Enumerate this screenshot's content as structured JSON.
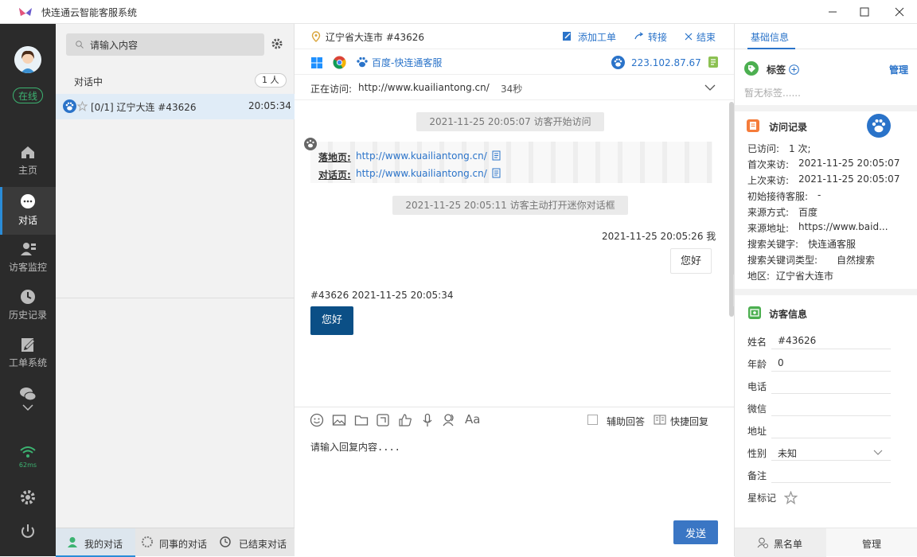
{
  "app": {
    "title": "快连通云智能客服系统"
  },
  "nav": {
    "status": "在线",
    "items": [
      {
        "label": "主页",
        "icon": "home-icon"
      },
      {
        "label": "对话",
        "icon": "chat-icon"
      },
      {
        "label": "访客监控",
        "icon": "monitor-icon"
      },
      {
        "label": "历史记录",
        "icon": "history-icon"
      },
      {
        "label": "工单系统",
        "icon": "ticket-icon"
      }
    ],
    "latency": "62ms"
  },
  "panel": {
    "search_placeholder": "请输入内容",
    "section_title": "对话中",
    "section_count": "1 人",
    "conversations": [
      {
        "title": "[0/1] 辽宁大连  #43626",
        "time": "20:05:34"
      }
    ],
    "tabs": {
      "mine": "我的对话",
      "colleague": "同事的对话",
      "ended": "已结束对话"
    }
  },
  "chat": {
    "location": "辽宁省大连市 #43626",
    "actions": {
      "add_ticket": "添加工单",
      "transfer": "转接",
      "end": "结束"
    },
    "source": "百度-快连通客服",
    "ip": "223.102.87.67",
    "visiting_label": "正在访问:",
    "visiting_url": "http://www.kuailiantong.cn/",
    "visiting_duration": "34秒",
    "sys_start": "2021-11-25 20:05:07 访客开始访问",
    "landing_label": "落地页:",
    "landing_url": "http://www.kuailiantong.cn/",
    "dialog_label": "对话页:",
    "dialog_url": "http://www.kuailiantong.cn/",
    "sys_open": "2021-11-25 20:05:11 访客主动打开迷你对话框",
    "msg_me": {
      "meta": "2021-11-25 20:05:26  我",
      "text": "您好"
    },
    "msg_visitor": {
      "meta": "#43626  2021-11-25 20:05:34",
      "text": "您好"
    },
    "assist": "辅助回答",
    "quick_reply": "快捷回复",
    "input_placeholder": "请输入回复内容....",
    "send": "发送"
  },
  "right": {
    "tab": "基础信息",
    "tags_title": "标签",
    "tags_manage": "管理",
    "tags_empty": "暂无标签......",
    "visits_title": "访问记录",
    "visits": [
      {
        "k": "已访问:",
        "v": "1 次;",
        "link": false
      },
      {
        "k": "首次来访:",
        "v": "2021-11-25 20:05:07",
        "link": false
      },
      {
        "k": "上次来访:",
        "v": "2021-11-25 20:05:07",
        "link": false
      },
      {
        "k": "初始接待客服:",
        "v": "-",
        "link": false
      },
      {
        "k": "来源方式:",
        "v": "百度",
        "link": false
      },
      {
        "k": "来源地址:",
        "v": "https://www.baid...",
        "link": true
      },
      {
        "k": "搜索关键字:",
        "v": "快连通客服",
        "link": true
      },
      {
        "k": "搜索关键词类型:",
        "v": "自然搜索",
        "link": false
      },
      {
        "k": "地区:",
        "v": "辽宁省大连市",
        "link": true
      }
    ],
    "visitor_title": "访客信息",
    "fields": [
      {
        "k": "姓名",
        "v": "#43626"
      },
      {
        "k": "年龄",
        "v": "0"
      },
      {
        "k": "电话",
        "v": ""
      },
      {
        "k": "微信",
        "v": ""
      },
      {
        "k": "地址",
        "v": ""
      },
      {
        "k": "性别",
        "v": "未知"
      },
      {
        "k": "备注",
        "v": ""
      },
      {
        "k": "星标记",
        "v": ""
      }
    ],
    "blacklist": "黑名单",
    "manage": "管理"
  },
  "colors": {
    "accent": "#2a73c9",
    "nav_bg": "#2b2b2b",
    "online": "#3cb371",
    "visitor_bubble": "#0b4f86",
    "send": "#3a76c4"
  }
}
